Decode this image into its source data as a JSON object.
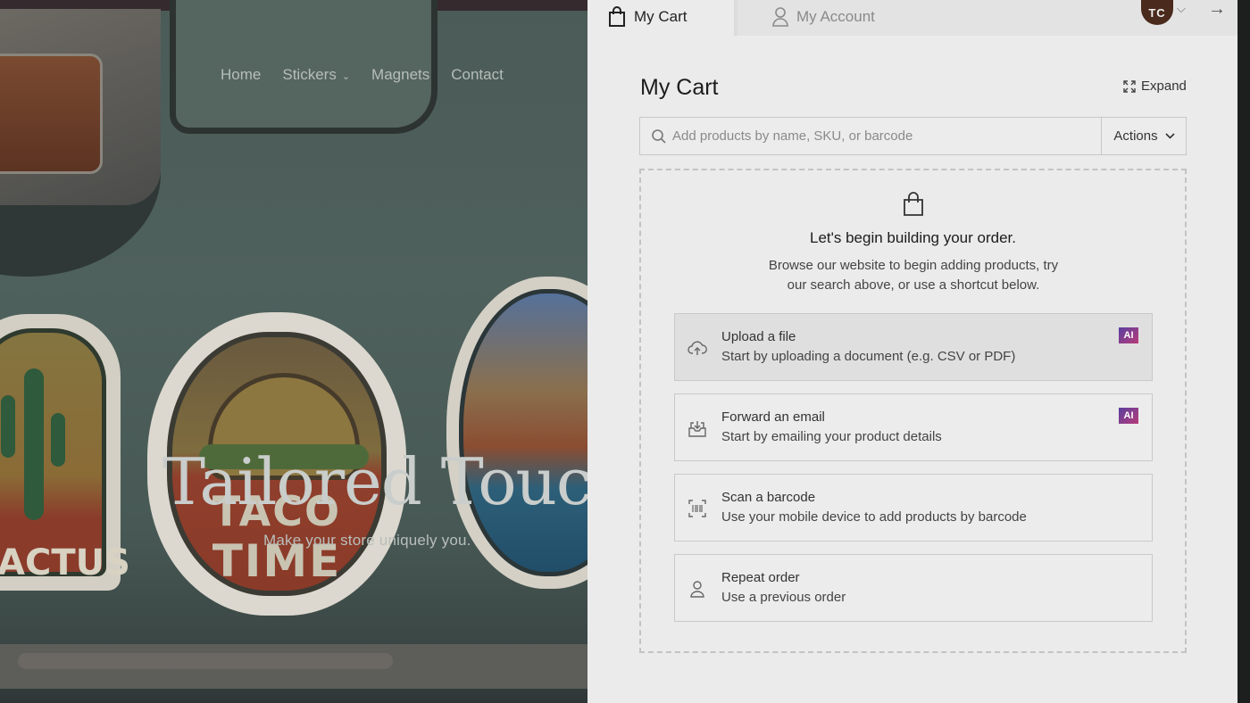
{
  "storefront": {
    "nav": [
      {
        "label": "Home"
      },
      {
        "label": "Stickers",
        "has_dropdown": true
      },
      {
        "label": "Magnets"
      },
      {
        "label": "Contact"
      }
    ],
    "hero_title": "Tailored Touch",
    "hero_subtitle": "Make your store uniquely you.",
    "sticker_taco_line1": "TACO",
    "sticker_taco_line2": "TIME",
    "sticker_cactus_text": "ACTUS"
  },
  "panel": {
    "tabs": {
      "cart": "My Cart",
      "account": "My Account"
    },
    "user_initials": "TC",
    "title": "My Cart",
    "expand_label": "Expand",
    "search": {
      "placeholder": "Add products by name, SKU, or barcode",
      "value": ""
    },
    "actions_label": "Actions",
    "empty": {
      "title": "Let's begin building your order.",
      "description": "Browse our website to begin adding products, try our search above, or use a shortcut below."
    },
    "shortcuts": [
      {
        "title": "Upload a file",
        "description": "Start by uploading a document (e.g. CSV or PDF)",
        "badge": "AI",
        "icon": "cloud-upload-icon"
      },
      {
        "title": "Forward an email",
        "description": "Start by emailing your product details",
        "badge": "AI",
        "icon": "inbox-download-icon"
      },
      {
        "title": "Scan a barcode",
        "description": "Use your mobile device to add products by barcode",
        "icon": "barcode-scan-icon"
      },
      {
        "title": "Repeat order",
        "description": "Use a previous order",
        "icon": "person-icon"
      }
    ]
  },
  "colors": {
    "avatar_bg": "#4a2a1c",
    "ai_badge_start": "#5a3fa0",
    "ai_badge_end": "#b83c78",
    "panel_bg": "#ebebeb"
  }
}
